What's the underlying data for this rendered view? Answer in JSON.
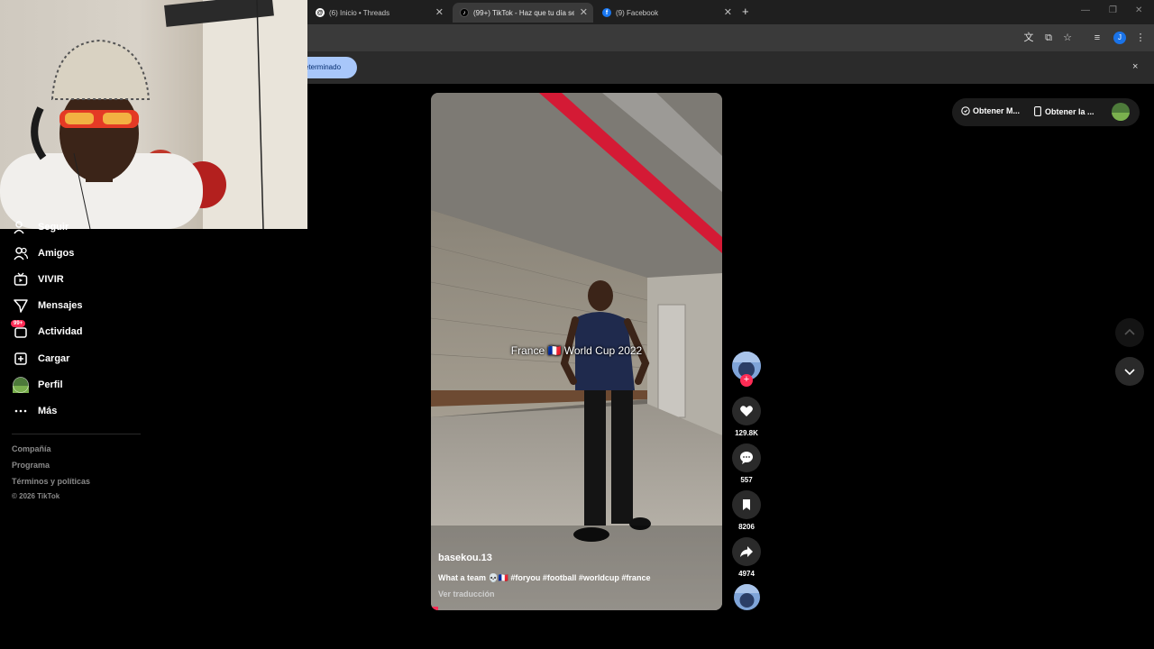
{
  "browser": {
    "tabs": [
      {
        "title": "(6) Inicio • Threads",
        "favicon": "threads-icon",
        "active": false
      },
      {
        "title": "(99+) TikTok - Haz que tu día se",
        "favicon": "tiktok-icon",
        "active": true
      },
      {
        "title": "(9) Facebook",
        "favicon": "facebook-icon",
        "active": false
      }
    ],
    "new_tab": "+",
    "profile_initial": "J",
    "infobar_button": "eterminado",
    "infobar_close": "×"
  },
  "sidebar": {
    "items": [
      {
        "label": "Seguir",
        "icon": "follow-icon"
      },
      {
        "label": "Amigos",
        "icon": "friends-icon"
      },
      {
        "label": "VIVIR",
        "icon": "live-icon"
      },
      {
        "label": "Mensajes",
        "icon": "messages-icon"
      },
      {
        "label": "Actividad",
        "icon": "activity-icon",
        "badge": "99+"
      },
      {
        "label": "Cargar",
        "icon": "upload-icon"
      },
      {
        "label": "Perfil",
        "icon": "profile-avatar"
      },
      {
        "label": "Más",
        "icon": "more-icon"
      }
    ],
    "footer": [
      "Compañía",
      "Programa",
      "Términos y políticas",
      "© 2026 TikTok"
    ]
  },
  "video": {
    "overlay_text": "France 🇫🇷 World Cup 2022",
    "username": "basekou.13",
    "description": "What a team 💀🇫🇷 #foryou #football #worldcup #france",
    "translate": "Ver traducción"
  },
  "actions": {
    "likes": "129.8K",
    "comments": "557",
    "saves": "8206",
    "shares": "4974"
  },
  "promo": {
    "item1": "Obtener M...",
    "item2": "Obtener la ..."
  },
  "colors": {
    "accent": "#fe2c55",
    "chrome_dark": "#1f1f1f",
    "chrome_toolbar": "#3a3a3a",
    "infobar_button": "#a8c7fa"
  }
}
